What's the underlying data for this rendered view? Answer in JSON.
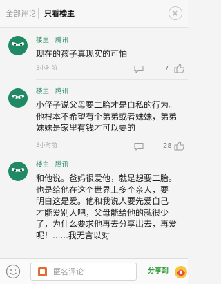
{
  "tabs": {
    "all": "全部评论",
    "host_only": "只看楼主"
  },
  "comments": [
    {
      "author": "楼主 · 腾讯",
      "text": "现在的孩子真现实的可怕",
      "time": "3小时前",
      "likes": "7"
    },
    {
      "author": "楼主 · 腾讯",
      "text": "小侄子说父母要二胎才是自私的行为。\n他根本不希望有个弟弟或者妹妹，弟弟\n妹妹是家里有钱才可以要的",
      "time": "3小时前",
      "likes": "28"
    },
    {
      "author": "楼主 · 腾讯",
      "text": "和他说。爸妈很爱他，就是想要二胎。\n也是给他在这个世界上多个亲人，要\n明白这是爱。他和我说人要先爱自己\n才能爱别人吧，父母能给他的就很少\n了，为什么要求他再去分享出去，再爱\n呢！......我无言以对",
      "time": "",
      "likes": ""
    }
  ],
  "bottom_bar": {
    "input_placeholder": "匿名评论",
    "share_label": "分享到"
  },
  "colors": {
    "accent_green": "#2b8a62",
    "avatar": "#1f8a63",
    "share_green": "#2f9a3c"
  },
  "icons": [
    "close-icon",
    "reply-icon",
    "like-icon",
    "emoji-icon",
    "comment-icon",
    "share-app-icon"
  ]
}
